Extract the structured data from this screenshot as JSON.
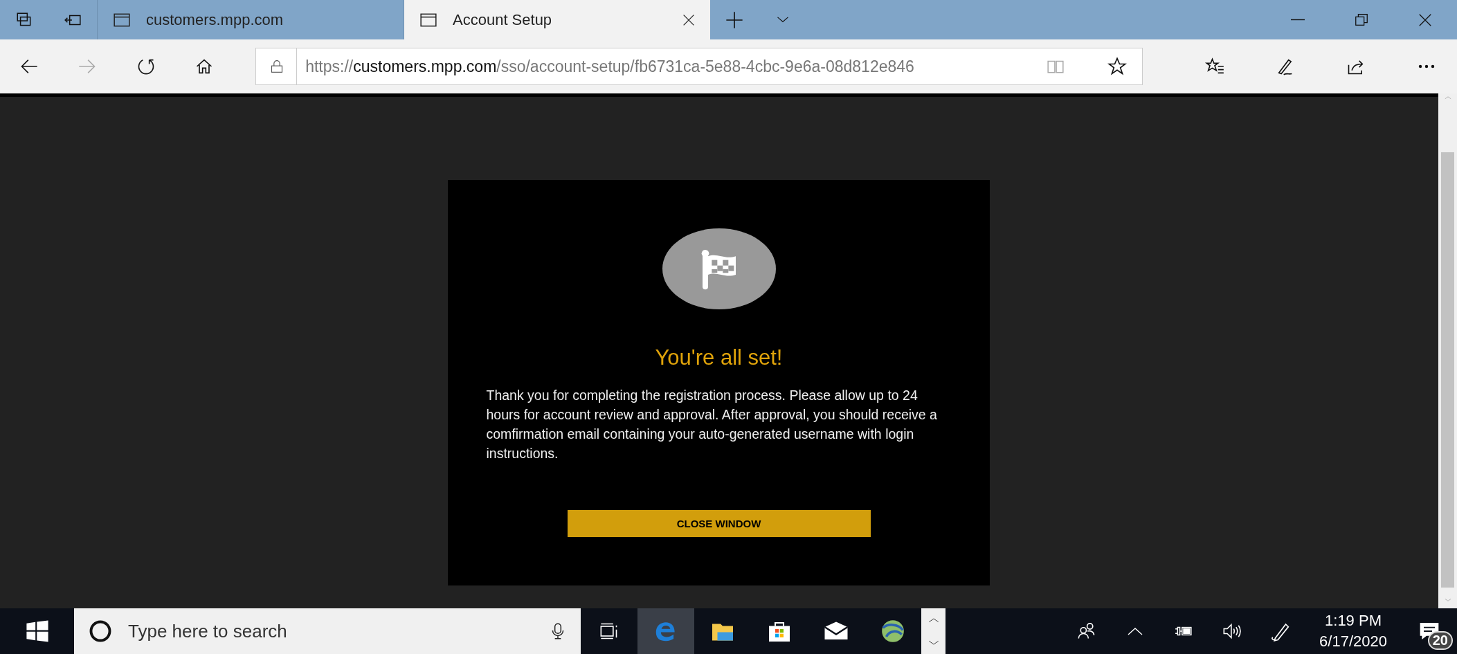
{
  "tabs": [
    {
      "label": "customers.mpp.com",
      "selected": false
    },
    {
      "label": "Account Setup",
      "selected": true
    }
  ],
  "address": {
    "scheme": "https://",
    "host": "customers.mpp.com",
    "path": "/sso/account-setup/fb6731ca-5e88-4cbc-9e6a-08d812e846"
  },
  "dialog": {
    "title": "You're all set!",
    "message": "Thank you for completing the registration process. Please allow up to 24 hours for account review and approval. After approval, you should receive a comfirmation email containing your auto-generated username with login instructions.",
    "button": "CLOSE WINDOW"
  },
  "taskbar": {
    "search_placeholder": "Type here to search",
    "time": "1:19 PM",
    "date": "6/17/2020",
    "notification_count": "20"
  }
}
